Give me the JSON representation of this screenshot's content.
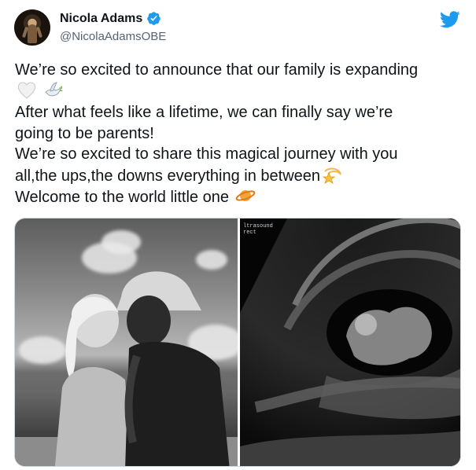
{
  "user": {
    "name": "Nicola Adams",
    "handle": "@NicolaAdamsOBE"
  },
  "icons": {
    "verified": "verified-badge-icon",
    "platform": "twitter-bird-icon"
  },
  "tweet": {
    "lines": [
      "We’re so excited to announce that our family is expanding",
      "",
      "After what feels like a lifetime, we can finally say we’re",
      "going to be parents!",
      "We’re so excited to share this magical journey with you",
      "all,the ups,the downs everything in between",
      "Welcome to the world little one"
    ],
    "emoji": [
      "white-heart",
      "dove",
      "dizzy-star",
      "ringed-planet"
    ]
  },
  "media": {
    "scan_label": "ltrasound\nrect",
    "scan_tag": "Volume\n58"
  },
  "colors": {
    "accent": "#1d9bf0",
    "text": "#0f1419",
    "secondary": "#536471"
  }
}
